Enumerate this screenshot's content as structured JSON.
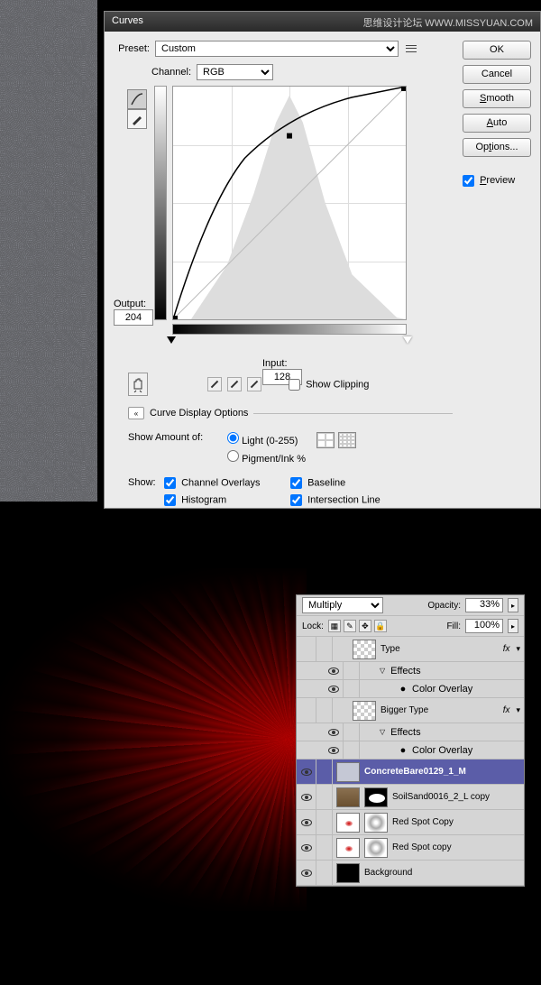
{
  "watermark": {
    "text1": "思维设计论坛",
    "text2": "WWW.MISSYUAN.COM"
  },
  "dialog": {
    "title": "Curves",
    "preset_label": "Preset:",
    "preset_value": "Custom",
    "channel_label": "Channel:",
    "channel_value": "RGB",
    "output_label": "Output:",
    "output_value": "204",
    "input_label": "Input:",
    "input_value": "128",
    "show_clipping": "Show Clipping",
    "curve_display_options": "Curve Display Options",
    "show_amount_label": "Show Amount of:",
    "light_label": "Light  (0-255)",
    "pigment_label": "Pigment/Ink %",
    "show_label": "Show:",
    "channel_overlays": "Channel Overlays",
    "histogram": "Histogram",
    "baseline": "Baseline",
    "intersection": "Intersection Line"
  },
  "buttons": {
    "ok": "OK",
    "cancel": "Cancel",
    "smooth": "Smooth",
    "auto": "Auto",
    "options": "Options...",
    "preview": "Preview"
  },
  "layers": {
    "blend_mode": "Multiply",
    "opacity_label": "Opacity:",
    "opacity_value": "33%",
    "lock_label": "Lock:",
    "fill_label": "Fill:",
    "fill_value": "100%",
    "items": [
      {
        "name": "Type",
        "has_fx": true,
        "effects": [
          "Color Overlay"
        ],
        "thumb": "checker"
      },
      {
        "name": "Bigger Type",
        "has_fx": true,
        "effects": [
          "Color Overlay"
        ],
        "thumb": "checker"
      },
      {
        "name": "ConcreteBare0129_1_M",
        "selected": true,
        "thumb": "concrete"
      },
      {
        "name": "SoilSand0016_2_L copy",
        "thumb": "soil",
        "mask": "oval"
      },
      {
        "name": "Red Spot Copy",
        "thumb": "redspot",
        "extra_thumb": "rays"
      },
      {
        "name": "Red Spot copy",
        "thumb": "redspot",
        "extra_thumb": "rays"
      },
      {
        "name": "Background",
        "thumb": "black"
      }
    ],
    "effects_label": "Effects"
  },
  "chart_data": {
    "type": "line",
    "title": "Curves",
    "xlabel": "Input",
    "ylabel": "Output",
    "xlim": [
      0,
      255
    ],
    "ylim": [
      0,
      255
    ],
    "series": [
      {
        "name": "curve",
        "x": [
          0,
          40,
          80,
          128,
          180,
          230,
          255
        ],
        "y": [
          0,
          100,
          160,
          204,
          230,
          247,
          255
        ]
      },
      {
        "name": "baseline",
        "x": [
          0,
          255
        ],
        "y": [
          0,
          255
        ]
      }
    ],
    "selected_point": {
      "input": 128,
      "output": 204
    },
    "histogram_peak_x": 128
  }
}
